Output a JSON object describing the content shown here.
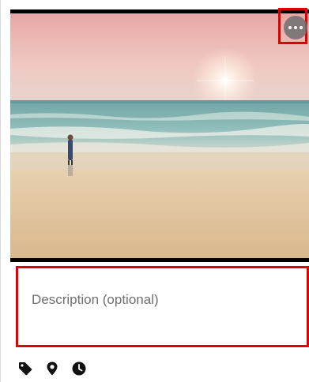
{
  "description": {
    "placeholder": "Description (optional)"
  },
  "photo": {
    "alt": "Beach at sunset with a person standing at the water's edge"
  },
  "toolbar": {
    "icons": [
      "tag-icon",
      "location-pin-icon",
      "clock-icon"
    ]
  },
  "colors": {
    "highlight": "#e00000",
    "icon": "#111111",
    "placeholder_text": "#6f6f6f"
  }
}
